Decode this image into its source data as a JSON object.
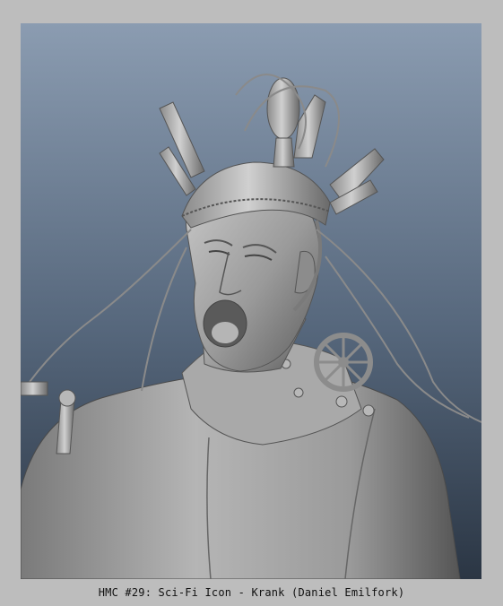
{
  "caption": "HMC #29: Sci-Fi Icon - Krank (Daniel Emilfork)",
  "colors": {
    "frame": "#bdbdbd",
    "viewport_top": "#8b9cb1",
    "viewport_bottom": "#2b3644",
    "model": "#9a9a9a"
  }
}
